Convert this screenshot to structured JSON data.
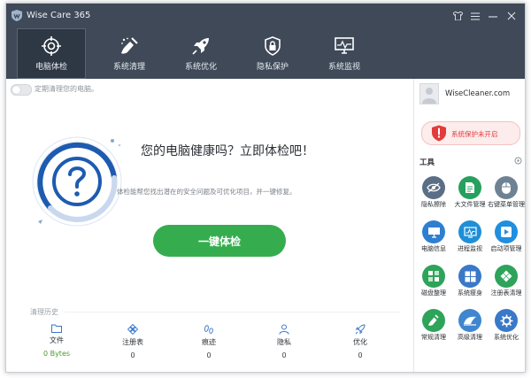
{
  "window": {
    "title": "Wise Care 365"
  },
  "nav": {
    "tabs": [
      {
        "label": "电脑体检",
        "icon": "target-icon"
      },
      {
        "label": "系统清理",
        "icon": "broom-icon"
      },
      {
        "label": "系统优化",
        "icon": "rocket-icon"
      },
      {
        "label": "隐私保护",
        "icon": "lock-shield-icon"
      },
      {
        "label": "系统监视",
        "icon": "monitor-icon"
      }
    ]
  },
  "main": {
    "auto_check_label": "定期清理您的电脑。",
    "headline": "您的电脑健康吗？立即体检吧！",
    "subtext": "体检能帮您找出潜在的安全问题及可优化项目，并一键修复。",
    "scan_button": "一键体检",
    "history_title": "清理历史",
    "history": [
      {
        "label": "文件",
        "value": "0 Bytes"
      },
      {
        "label": "注册表",
        "value": "0"
      },
      {
        "label": "痕迹",
        "value": "0"
      },
      {
        "label": "隐私",
        "value": "0"
      },
      {
        "label": "优化",
        "value": "0"
      }
    ]
  },
  "sidebar": {
    "account_name": "WiseCleaner.com",
    "protection_status": "系统保护未开启",
    "tools_title": "工具",
    "tools": [
      {
        "label": "隐私擦除"
      },
      {
        "label": "大文件管理"
      },
      {
        "label": "右键菜单管理"
      },
      {
        "label": "电脑信息"
      },
      {
        "label": "进程监视"
      },
      {
        "label": "启动项管理"
      },
      {
        "label": "磁盘整理"
      },
      {
        "label": "系统瘦身"
      },
      {
        "label": "注册表清理"
      },
      {
        "label": "常规清理"
      },
      {
        "label": "高级清理"
      },
      {
        "label": "系统优化"
      }
    ]
  },
  "colors": {
    "titlebar": "#3f4958",
    "accent_green": "#35ad4f",
    "alert_red": "#e23b3b",
    "ring_blue": "#1e5bb0"
  }
}
